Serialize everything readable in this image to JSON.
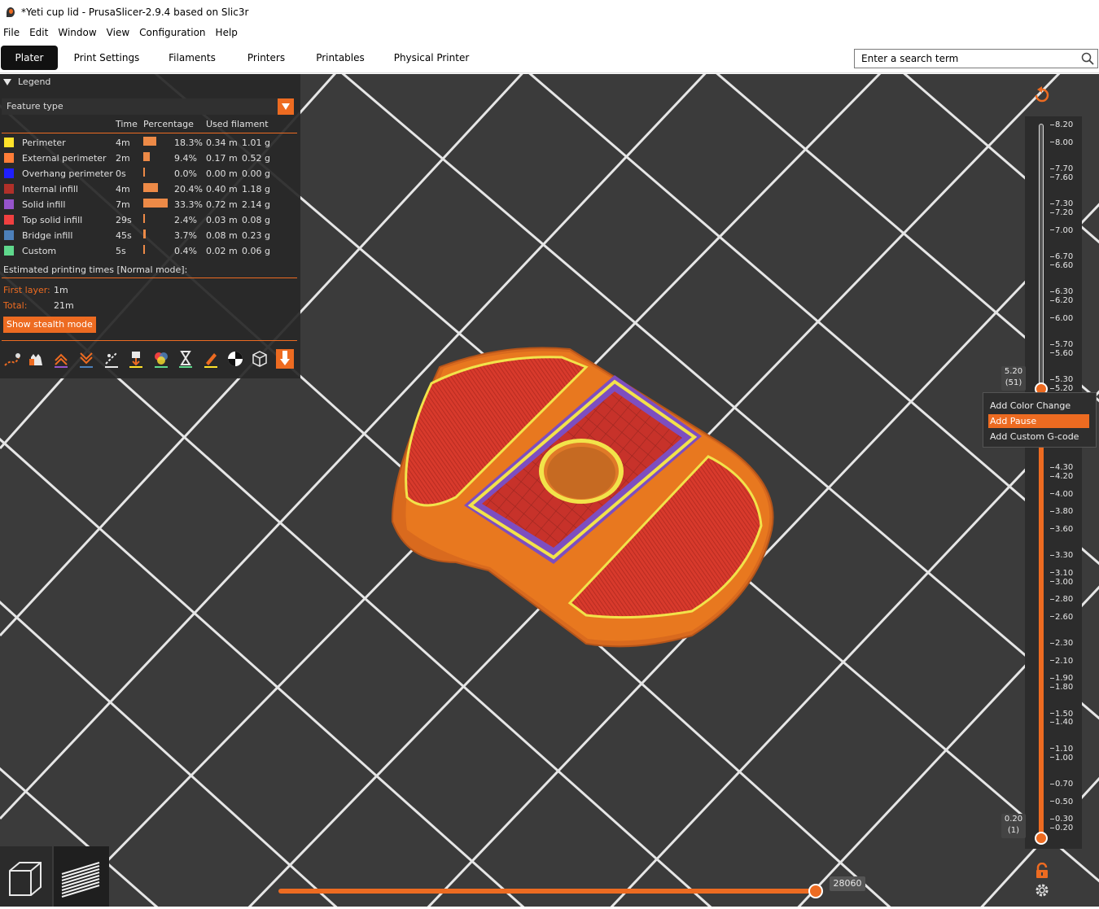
{
  "window": {
    "title": "*Yeti cup lid - PrusaSlicer-2.9.4 based on Slic3r"
  },
  "menu": [
    "File",
    "Edit",
    "Window",
    "View",
    "Configuration",
    "Help"
  ],
  "tabs": [
    "Plater",
    "Print Settings",
    "Filaments",
    "Printers",
    "Printables",
    "Physical Printer"
  ],
  "search": {
    "placeholder": "Enter a search term"
  },
  "legend": {
    "title": "Legend",
    "view_type": "Feature type",
    "columns": [
      "Time",
      "Percentage",
      "Used filament"
    ],
    "features": [
      {
        "name": "Perimeter",
        "color": "#ffe22a",
        "time": "4m",
        "percentage": "18.3%",
        "fraction": 0.183,
        "length": "0.34 m",
        "weight": "1.01 g"
      },
      {
        "name": "External perimeter",
        "color": "#ff7d38",
        "time": "2m",
        "percentage": "9.4%",
        "fraction": 0.094,
        "length": "0.17 m",
        "weight": "0.52 g"
      },
      {
        "name": "Overhang perimeter",
        "color": "#1f1fff",
        "time": "0s",
        "percentage": "0.0%",
        "fraction": 0.0,
        "length": "0.00 m",
        "weight": "0.00 g"
      },
      {
        "name": "Internal infill",
        "color": "#b03029",
        "time": "4m",
        "percentage": "20.4%",
        "fraction": 0.204,
        "length": "0.40 m",
        "weight": "1.18 g"
      },
      {
        "name": "Solid infill",
        "color": "#9654cc",
        "time": "7m",
        "percentage": "33.3%",
        "fraction": 0.333,
        "length": "0.72 m",
        "weight": "2.14 g"
      },
      {
        "name": "Top solid infill",
        "color": "#f04040",
        "time": "29s",
        "percentage": "2.4%",
        "fraction": 0.024,
        "length": "0.03 m",
        "weight": "0.08 g"
      },
      {
        "name": "Bridge infill",
        "color": "#4d80ba",
        "time": "45s",
        "percentage": "3.7%",
        "fraction": 0.037,
        "length": "0.08 m",
        "weight": "0.23 g"
      },
      {
        "name": "Custom",
        "color": "#5fd88c",
        "time": "5s",
        "percentage": "0.4%",
        "fraction": 0.004,
        "length": "0.02 m",
        "weight": "0.06 g"
      }
    ],
    "estimated_label": "Estimated printing times [Normal mode]:",
    "first_layer_label": "First layer:",
    "first_layer_value": "1m",
    "total_label": "Total:",
    "total_value": "21m",
    "stealth_button": "Show stealth mode",
    "toolbar_icons": [
      "travel-icon",
      "wipe-icon",
      "retractions-icon",
      "deretractions-icon",
      "seams-icon",
      "tool-changes-icon",
      "color-changes-icon",
      "pause-prints-icon",
      "custom-gcodes-icon",
      "center-of-gravity-icon",
      "shells-icon",
      "tool-marker-icon"
    ]
  },
  "vertical_slider": {
    "ticks": [
      "8.20",
      "8.00",
      "7.70",
      "7.60",
      "7.30",
      "7.20",
      "7.00",
      "6.70",
      "6.60",
      "6.30",
      "6.20",
      "6.00",
      "5.70",
      "5.60",
      "5.30",
      "5.20",
      "4.30",
      "4.20",
      "4.00",
      "3.80",
      "3.60",
      "3.30",
      "3.10",
      "3.00",
      "2.80",
      "2.60",
      "2.30",
      "2.10",
      "1.90",
      "1.80",
      "1.50",
      "1.40",
      "1.10",
      "1.00",
      "0.70",
      "0.50",
      "0.30",
      "0.20"
    ],
    "upper": {
      "value": "5.20",
      "layer": "(51)"
    },
    "lower": {
      "value": "0.20",
      "layer": "(1)"
    },
    "context_menu": [
      "Add Color Change",
      "Add Pause",
      "Add Custom G-code"
    ]
  },
  "horizontal_slider": {
    "value": "28060",
    "fraction": 0.98
  },
  "colors": {
    "accent": "#ed6b21",
    "background": "#3b3b3b",
    "grid": "#e6e6e6"
  }
}
